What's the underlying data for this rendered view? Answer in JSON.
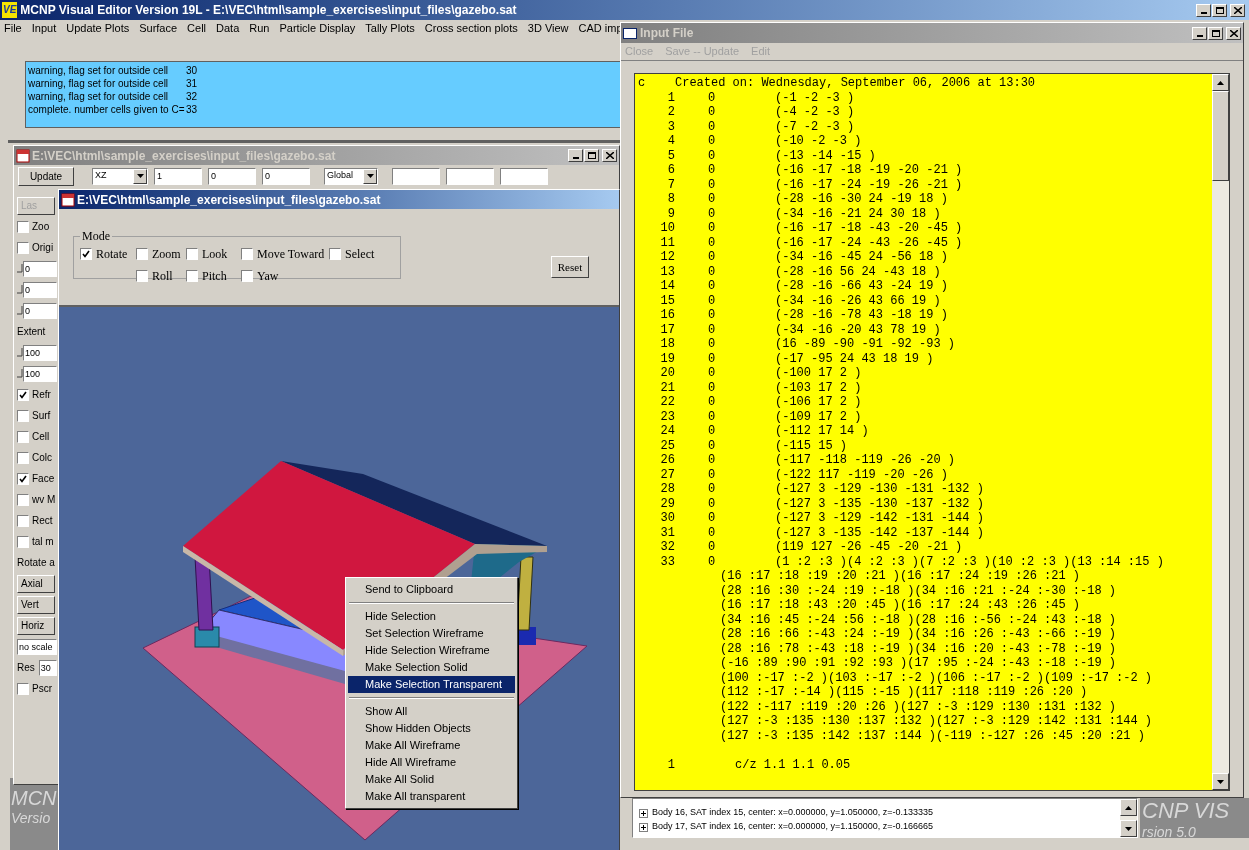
{
  "main_window": {
    "app_icon": "VE",
    "title": "MCNP Visual Editor Version 19L - E:\\VEC\\html\\sample_exercises\\input_files\\gazebo.sat",
    "menu": [
      "File",
      "Input",
      "Update Plots",
      "Surface",
      "Cell",
      "Data",
      "Run",
      "Particle Display",
      "Tally Plots",
      "Cross section plots",
      "3D View",
      "CAD imp"
    ],
    "log": [
      {
        "text": "warning, flag set for outside cell",
        "value": "30"
      },
      {
        "text": "warning, flag set for outside cell",
        "value": "31"
      },
      {
        "text": "warning, flag set for outside cell",
        "value": "32"
      },
      {
        "text": "complete. number cells given to C=",
        "value": "33"
      }
    ]
  },
  "plot_window": {
    "title": "E:\\VEC\\html\\sample_exercises\\input_files\\gazebo.sat",
    "toolbar": {
      "update": "Update",
      "view": "XZ",
      "fields": [
        "1",
        "0",
        "0"
      ],
      "frame": "Global"
    },
    "side_panel": [
      {
        "kind": "button",
        "label": "Las",
        "disabled": true
      },
      {
        "kind": "check",
        "label": "Zoo",
        "checked": false
      },
      {
        "kind": "check",
        "label": "Origi",
        "checked": false
      },
      {
        "kind": "slider",
        "value": "0"
      },
      {
        "kind": "slider",
        "value": "0"
      },
      {
        "kind": "slider",
        "value": "0"
      },
      {
        "kind": "label",
        "label": "Extent"
      },
      {
        "kind": "slider",
        "value": "100"
      },
      {
        "kind": "slider",
        "value": "100"
      },
      {
        "kind": "check",
        "label": "Refr",
        "checked": true
      },
      {
        "kind": "check",
        "label": "Surf",
        "checked": false
      },
      {
        "kind": "check",
        "label": "Cell",
        "checked": false
      },
      {
        "kind": "check",
        "label": "Colc",
        "checked": false
      },
      {
        "kind": "check",
        "label": "Face",
        "checked": true
      },
      {
        "kind": "check",
        "label": "wv M",
        "checked": false
      },
      {
        "kind": "check",
        "label": "Rect",
        "checked": false
      },
      {
        "kind": "check",
        "label": "tal m",
        "checked": false
      },
      {
        "kind": "label",
        "label": "Rotate a"
      },
      {
        "kind": "button",
        "label": "Axial",
        "disabled": false
      },
      {
        "kind": "button",
        "label": "Vert",
        "disabled": false
      },
      {
        "kind": "button",
        "label": "Horiz",
        "disabled": false
      },
      {
        "kind": "field",
        "value": "no scale"
      },
      {
        "kind": "labeled_field",
        "label": "Res",
        "value": "30"
      },
      {
        "kind": "check",
        "label": "Pscr",
        "checked": false
      }
    ]
  },
  "view_window": {
    "title": "E:\\VEC\\html\\sample_exercises\\input_files\\gazebo.sat",
    "mode": {
      "legend": "Mode",
      "rows": [
        [
          {
            "kind": "option",
            "label": "Rotate",
            "checked": true
          },
          {
            "kind": "option",
            "label": "Zoom",
            "checked": false
          },
          {
            "kind": "option",
            "label": "Look",
            "checked": false
          },
          {
            "kind": "option",
            "label": "Move Toward",
            "checked": false
          },
          {
            "kind": "option",
            "label": "Select",
            "checked": false
          }
        ],
        [
          {
            "kind": "spacer"
          },
          {
            "kind": "option",
            "label": "Roll",
            "checked": false
          },
          {
            "kind": "option",
            "label": "Pitch",
            "checked": false
          },
          {
            "kind": "option",
            "label": "Yaw",
            "checked": false
          }
        ]
      ]
    },
    "reset": "Reset",
    "context_menu": [
      [
        {
          "label": "Send to Clipboard",
          "selected": false
        }
      ],
      [
        {
          "label": "Hide Selection",
          "selected": false
        },
        {
          "label": "Set Selection Wireframe",
          "selected": false
        },
        {
          "label": "Hide Selection Wireframe",
          "selected": false
        },
        {
          "label": "Make Selection Solid",
          "selected": false
        },
        {
          "label": "Make Selection Transparent",
          "selected": true
        }
      ],
      [
        {
          "label": "Show All",
          "selected": false
        },
        {
          "label": "Show Hidden Objects",
          "selected": false
        },
        {
          "label": "Make All Wireframe",
          "selected": false
        },
        {
          "label": "Hide All Wireframe",
          "selected": false
        },
        {
          "label": "Make All Solid",
          "selected": false
        },
        {
          "label": "Make All transparent",
          "selected": false
        }
      ]
    ]
  },
  "input_file": {
    "title": "Input File",
    "menu": [
      {
        "label": "Close",
        "disabled": true
      },
      {
        "label": "Save -- Update",
        "disabled": true
      },
      {
        "label": "Edit",
        "disabled": true
      }
    ],
    "lines": [
      {
        "kind": "comment",
        "marker": "c",
        "text": "Created on: Wednesday, September 06, 2006 at 13:30"
      },
      {
        "kind": "cell",
        "number": "1",
        "material": "0",
        "geometry": "(-1 -2 -3 )"
      },
      {
        "kind": "cell",
        "number": "2",
        "material": "0",
        "geometry": "(-4 -2 -3 )"
      },
      {
        "kind": "cell",
        "number": "3",
        "material": "0",
        "geometry": "(-7 -2 -3 )"
      },
      {
        "kind": "cell",
        "number": "4",
        "material": "0",
        "geometry": "(-10 -2 -3 )"
      },
      {
        "kind": "cell",
        "number": "5",
        "material": "0",
        "geometry": "(-13 -14 -15 )"
      },
      {
        "kind": "cell",
        "number": "6",
        "material": "0",
        "geometry": "(-16 -17 -18 -19 -20 -21 )"
      },
      {
        "kind": "cell",
        "number": "7",
        "material": "0",
        "geometry": "(-16 -17 -24 -19 -26 -21 )"
      },
      {
        "kind": "cell",
        "number": "8",
        "material": "0",
        "geometry": "(-28 -16 -30 24 -19 18 )"
      },
      {
        "kind": "cell",
        "number": "9",
        "material": "0",
        "geometry": "(-34 -16 -21 24 30 18 )"
      },
      {
        "kind": "cell",
        "number": "10",
        "material": "0",
        "geometry": "(-16 -17 -18 -43 -20 -45 )"
      },
      {
        "kind": "cell",
        "number": "11",
        "material": "0",
        "geometry": "(-16 -17 -24 -43 -26 -45 )"
      },
      {
        "kind": "cell",
        "number": "12",
        "material": "0",
        "geometry": "(-34 -16 -45 24 -56 18 )"
      },
      {
        "kind": "cell",
        "number": "13",
        "material": "0",
        "geometry": "(-28 -16 56 24 -43 18 )"
      },
      {
        "kind": "cell",
        "number": "14",
        "material": "0",
        "geometry": "(-28 -16 -66 43 -24 19 )"
      },
      {
        "kind": "cell",
        "number": "15",
        "material": "0",
        "geometry": "(-34 -16 -26 43 66 19 )"
      },
      {
        "kind": "cell",
        "number": "16",
        "material": "0",
        "geometry": "(-28 -16 -78 43 -18 19 )"
      },
      {
        "kind": "cell",
        "number": "17",
        "material": "0",
        "geometry": "(-34 -16 -20 43 78 19 )"
      },
      {
        "kind": "cell",
        "number": "18",
        "material": "0",
        "geometry": "(16 -89 -90 -91 -92 -93 )"
      },
      {
        "kind": "cell",
        "number": "19",
        "material": "0",
        "geometry": "(-17 -95 24 43 18 19 )"
      },
      {
        "kind": "cell",
        "number": "20",
        "material": "0",
        "geometry": "(-100 17 2 )"
      },
      {
        "kind": "cell",
        "number": "21",
        "material": "0",
        "geometry": "(-103 17 2 )"
      },
      {
        "kind": "cell",
        "number": "22",
        "material": "0",
        "geometry": "(-106 17 2 )"
      },
      {
        "kind": "cell",
        "number": "23",
        "material": "0",
        "geometry": "(-109 17 2 )"
      },
      {
        "kind": "cell",
        "number": "24",
        "material": "0",
        "geometry": "(-112 17 14 )"
      },
      {
        "kind": "cell",
        "number": "25",
        "material": "0",
        "geometry": "(-115 15 )"
      },
      {
        "kind": "cell",
        "number": "26",
        "material": "0",
        "geometry": "(-117 -118 -119 -26 -20 )"
      },
      {
        "kind": "cell",
        "number": "27",
        "material": "0",
        "geometry": "(-122 117 -119 -20 -26 )"
      },
      {
        "kind": "cell",
        "number": "28",
        "material": "0",
        "geometry": "(-127 3 -129 -130 -131 -132 )"
      },
      {
        "kind": "cell",
        "number": "29",
        "material": "0",
        "geometry": "(-127 3 -135 -130 -137 -132 )"
      },
      {
        "kind": "cell",
        "number": "30",
        "material": "0",
        "geometry": "(-127 3 -129 -142 -131 -144 )"
      },
      {
        "kind": "cell",
        "number": "31",
        "material": "0",
        "geometry": "(-127 3 -135 -142 -137 -144 )"
      },
      {
        "kind": "cell",
        "number": "32",
        "material": "0",
        "geometry": "(119 127 -26 -45 -20 -21 )"
      },
      {
        "kind": "cell",
        "number": "33",
        "material": "0",
        "geometry": "(1 :2 :3 )(4 :2 :3 )(7 :2 :3 )(10 :2 :3 )(13 :14 :15 )"
      },
      {
        "kind": "continuation",
        "text": "(16 :17 :18 :19 :20 :21 )(16 :17 :24 :19 :26 :21 )"
      },
      {
        "kind": "continuation",
        "text": "(28 :16 :30 :-24 :19 :-18 )(34 :16 :21 :-24 :-30 :-18 )"
      },
      {
        "kind": "continuation",
        "text": "(16 :17 :18 :43 :20 :45 )(16 :17 :24 :43 :26 :45 )"
      },
      {
        "kind": "continuation",
        "text": "(34 :16 :45 :-24 :56 :-18 )(28 :16 :-56 :-24 :43 :-18 )"
      },
      {
        "kind": "continuation",
        "text": "(28 :16 :66 :-43 :24 :-19 )(34 :16 :26 :-43 :-66 :-19 )"
      },
      {
        "kind": "continuation",
        "text": "(28 :16 :78 :-43 :18 :-19 )(34 :16 :20 :-43 :-78 :-19 )"
      },
      {
        "kind": "continuation",
        "text": "(-16 :89 :90 :91 :92 :93 )(17 :95 :-24 :-43 :-18 :-19 )"
      },
      {
        "kind": "continuation",
        "text": "(100 :-17 :-2 )(103 :-17 :-2 )(106 :-17 :-2 )(109 :-17 :-2 )"
      },
      {
        "kind": "continuation",
        "text": "(112 :-17 :-14 )(115 :-15 )(117 :118 :119 :26 :20 )"
      },
      {
        "kind": "continuation",
        "text": "(122 :-117 :119 :20 :26 )(127 :-3 :129 :130 :131 :132 )"
      },
      {
        "kind": "continuation",
        "text": "(127 :-3 :135 :130 :137 :132 )(127 :-3 :129 :142 :131 :144 )"
      },
      {
        "kind": "continuation",
        "text": "(127 :-3 :135 :142 :137 :144 )(-119 :-127 :26 :45 :20 :21 )"
      },
      {
        "kind": "blank"
      },
      {
        "kind": "surface",
        "number": "1",
        "text": "c/z 1.1 1.1 0.05"
      }
    ]
  },
  "body_list": [
    "Body 16, SAT index 15, center: x=0.000000, y=1.050000, z=-0.133335",
    "Body 17, SAT index 16, center: x=0.000000, y=1.150000, z=-0.166665"
  ],
  "logos": {
    "left": [
      "MCN",
      "Versio"
    ],
    "right": [
      "CNP VIS",
      "rsion 5.0"
    ]
  }
}
